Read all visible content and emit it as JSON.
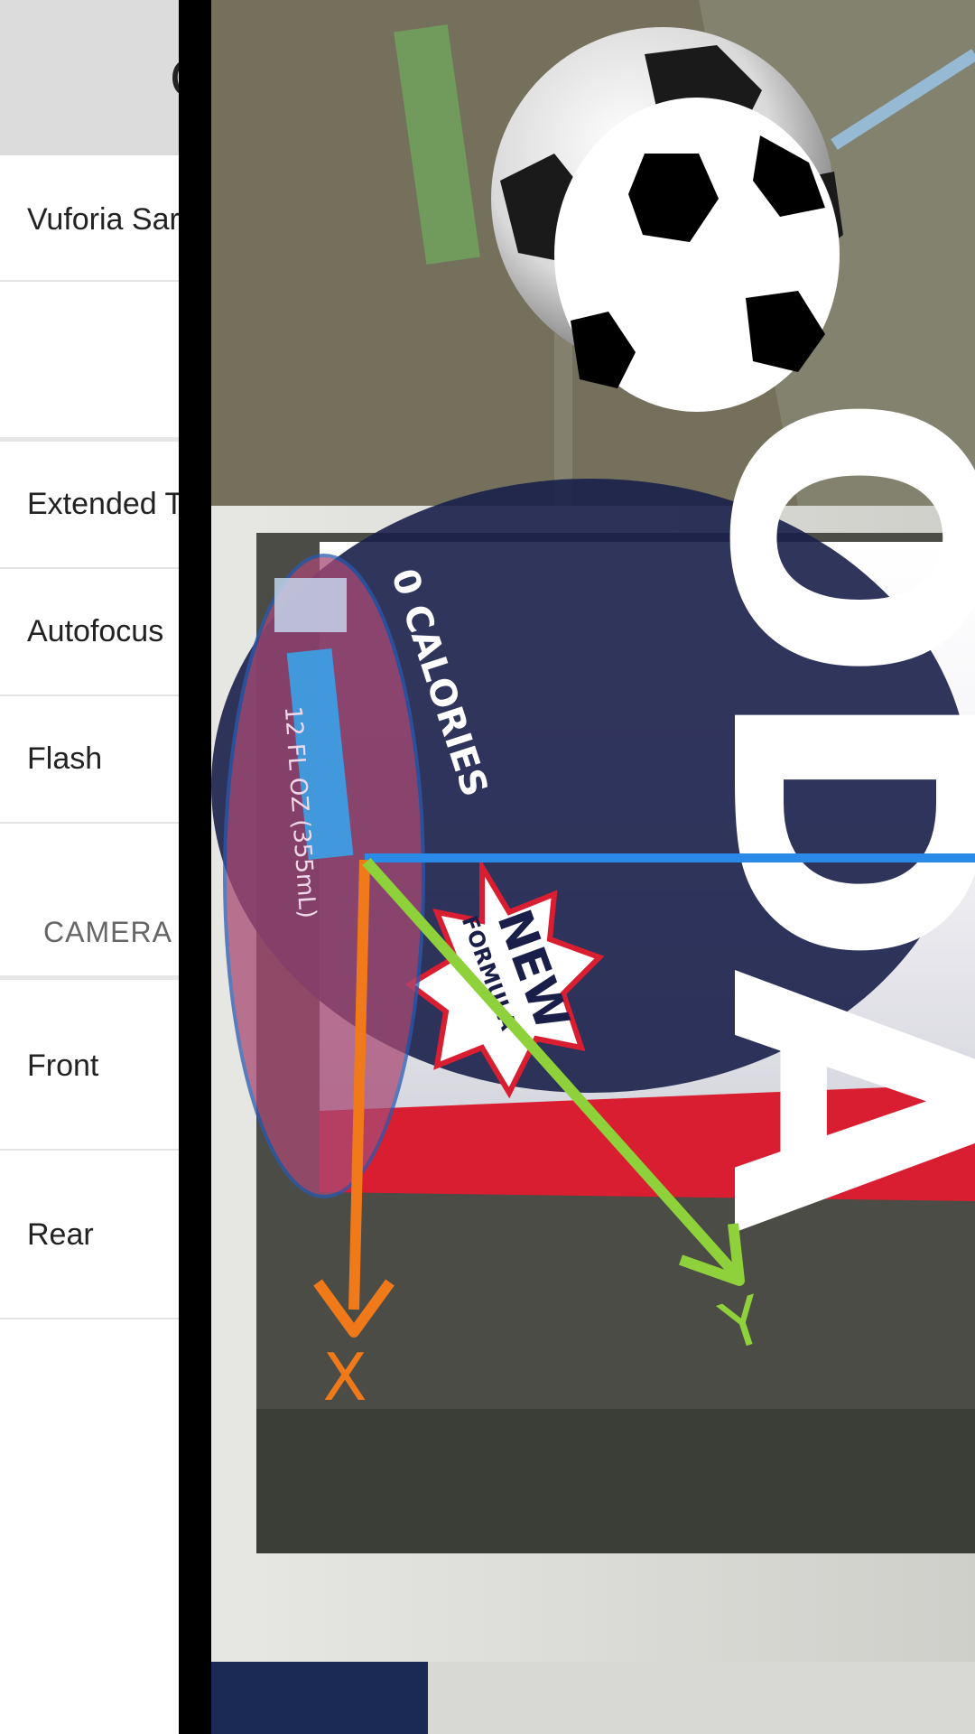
{
  "drawer": {
    "header_title": "C",
    "items": [
      {
        "label": "Vuforia Sar"
      },
      {
        "label": "Extended T"
      },
      {
        "label": "Autofocus"
      },
      {
        "label": "Flash"
      }
    ],
    "camera_section": {
      "title": "CAMERA",
      "options": [
        {
          "label": "Front"
        },
        {
          "label": "Rear"
        }
      ]
    }
  },
  "ar_view": {
    "axis_labels": {
      "x": "X",
      "y": "Y"
    },
    "can_text": {
      "brand": "ODA",
      "badge_line1": "NEW",
      "badge_line2": "FORMULA",
      "rim_text": "0 CALORIES",
      "volume_text": "12 FL OZ (355mL)"
    },
    "colors": {
      "x_axis": "#f07a1a",
      "y_axis": "#8fd13a",
      "z_axis": "#2a8ae8",
      "can_red": "#d81e30",
      "can_navy": "#1a1f4a"
    }
  }
}
